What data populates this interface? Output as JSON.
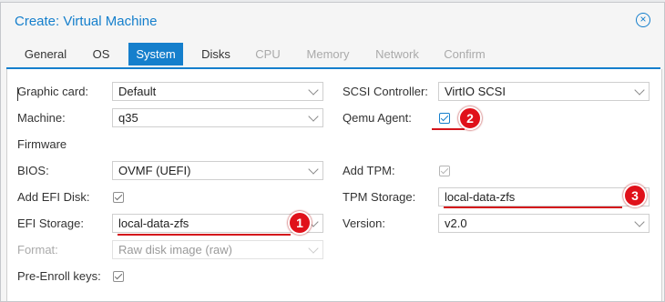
{
  "window": {
    "title": "Create: Virtual Machine"
  },
  "tabs": [
    {
      "label": "General",
      "state": "normal"
    },
    {
      "label": "OS",
      "state": "normal"
    },
    {
      "label": "System",
      "state": "active"
    },
    {
      "label": "Disks",
      "state": "normal"
    },
    {
      "label": "CPU",
      "state": "disabled"
    },
    {
      "label": "Memory",
      "state": "disabled"
    },
    {
      "label": "Network",
      "state": "disabled"
    },
    {
      "label": "Confirm",
      "state": "disabled"
    }
  ],
  "left": {
    "graphic_card": {
      "label": "Graphic card:",
      "value": "Default"
    },
    "machine": {
      "label": "Machine:",
      "value": "q35"
    },
    "firmware_heading": "Firmware",
    "bios": {
      "label": "BIOS:",
      "value": "OVMF (UEFI)"
    },
    "add_efi_disk": {
      "label": "Add EFI Disk:",
      "checked": true
    },
    "efi_storage": {
      "label": "EFI Storage:",
      "value": "local-data-zfs"
    },
    "format": {
      "label": "Format:",
      "value": "Raw disk image (raw)"
    },
    "pre_enroll": {
      "label": "Pre-Enroll keys:",
      "checked": true
    }
  },
  "right": {
    "scsi_controller": {
      "label": "SCSI Controller:",
      "value": "VirtIO SCSI"
    },
    "qemu_agent": {
      "label": "Qemu Agent:",
      "checked": true
    },
    "add_tpm": {
      "label": "Add TPM:",
      "checked": true
    },
    "tpm_storage": {
      "label": "TPM Storage:",
      "value": "local-data-zfs"
    },
    "version": {
      "label": "Version:",
      "value": "v2.0"
    }
  },
  "annotations": [
    "1",
    "2",
    "3"
  ],
  "colors": {
    "accent": "#157fcc",
    "marker": "#e0111a"
  },
  "icons": {
    "close": "close-circle-icon",
    "dropdown": "chevron-down-icon",
    "check": "checkbox-checked-icon"
  }
}
